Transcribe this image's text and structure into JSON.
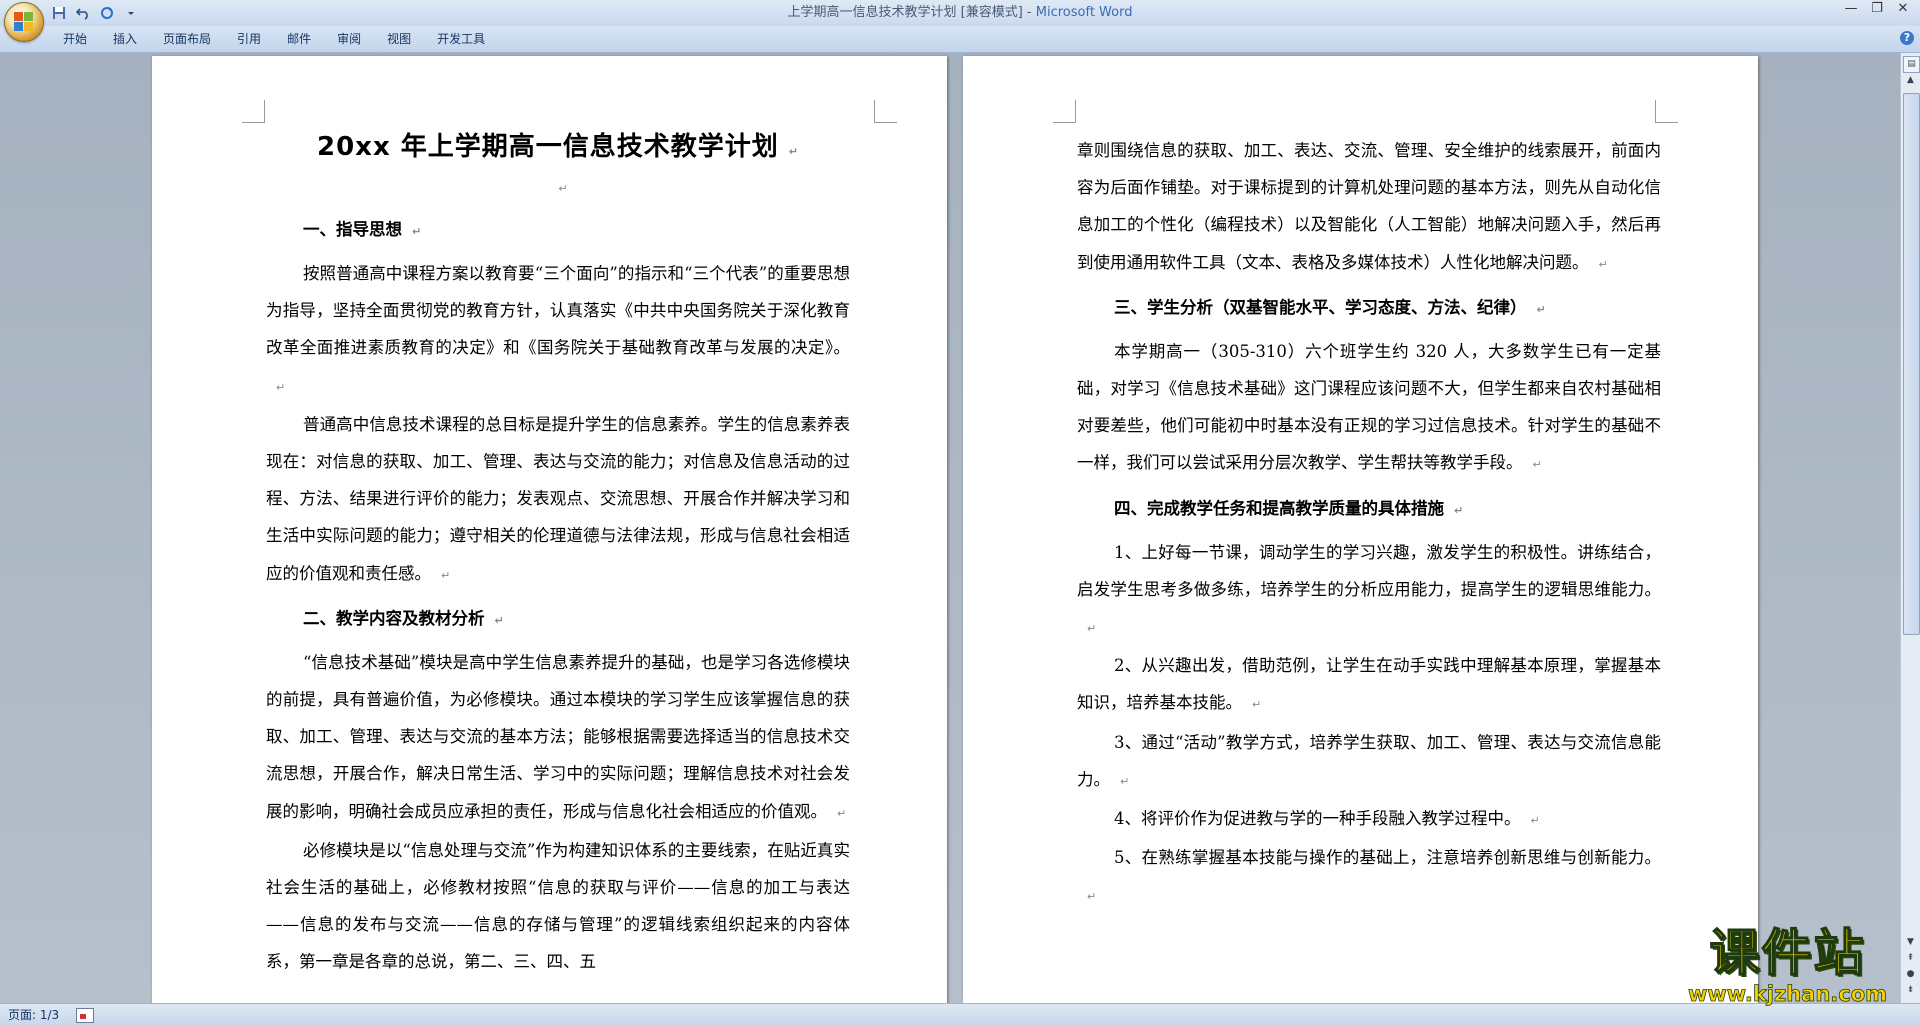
{
  "window": {
    "doc_title": "上学期高一信息技术教学计划 [兼容模式] - ",
    "app_name": "Microsoft Word",
    "qat": [
      "save-icon",
      "undo-icon",
      "redo-icon",
      "customize-icon"
    ]
  },
  "ribbon": {
    "tabs": [
      "开始",
      "插入",
      "页面布局",
      "引用",
      "邮件",
      "审阅",
      "视图",
      "开发工具"
    ]
  },
  "page1": {
    "title": "20xx 年上学期高一信息技术教学计划",
    "h1": "一、指导思想",
    "p1": "按照普通高中课程方案以教育要“三个面向”的指示和“三个代表”的重要思想为指导，坚持全面贯彻党的教育方针，认真落实《中共中央国务院关于深化教育改革全面推进素质教育的决定》和《国务院关于基础教育改革与发展的决定》。",
    "p2": "普通高中信息技术课程的总目标是提升学生的信息素养。学生的信息素养表现在：对信息的获取、加工、管理、表达与交流的能力；对信息及信息活动的过程、方法、结果进行评价的能力；发表观点、交流思想、开展合作并解决学习和生活中实际问题的能力；遵守相关的伦理道德与法律法规，形成与信息社会相适应的价值观和责任感。",
    "h2": "二、教学内容及教材分析",
    "p3": "“信息技术基础”模块是高中学生信息素养提升的基础，也是学习各选修模块的前提，具有普遍价值，为必修模块。通过本模块的学习学生应该掌握信息的获取、加工、管理、表达与交流的基本方法；能够根据需要选择适当的信息技术交流思想，开展合作，解决日常生活、学习中的实际问题；理解信息技术对社会发展的影响，明确社会成员应承担的责任，形成与信息化社会相适应的价值观。",
    "p4": "必修模块是以“信息处理与交流”作为构建知识体系的主要线索，在贴近真实社会生活的基础上，必修教材按照“信息的获取与评价——信息的加工与表达——信息的发布与交流——信息的存储与管理”的逻辑线索组织起来的内容体系，第一章是各章的总说，第二、三、四、五"
  },
  "page2": {
    "p1": "章则围绕信息的获取、加工、表达、交流、管理、安全维护的线索展开，前面内容为后面作铺垫。对于课标提到的计算机处理问题的基本方法，则先从自动化信息加工的个性化（编程技术）以及智能化（人工智能）地解决问题入手，然后再到使用通用软件工具（文本、表格及多媒体技术）人性化地解决问题。",
    "h3": "三、学生分析（双基智能水平、学习态度、方法、纪律）",
    "p2": "本学期高一（305-310）六个班学生约 320 人，大多数学生已有一定基础，对学习《信息技术基础》这门课程应该问题不大，但学生都来自农村基础相对要差些，他们可能初中时基本没有正规的学习过信息技术。针对学生的基础不一样，我们可以尝试采用分层次教学、学生帮扶等教学手段。",
    "h4": "四、完成教学任务和提高教学质量的具体措施",
    "m1": "1、上好每一节课，调动学生的学习兴趣，激发学生的积极性。讲练结合，启发学生思考多做多练，培养学生的分析应用能力，提高学生的逻辑思维能力。",
    "m2": "2、从兴趣出发，借助范例，让学生在动手实践中理解基本原理，掌握基本知识，培养基本技能。",
    "m3": "3、通过“活动”教学方式，培养学生获取、加工、管理、表达与交流信息能力。",
    "m4": "4、将评价作为促进教与学的一种手段融入教学过程中。",
    "m5": "5、在熟练掌握基本技能与操作的基础上，注意培养创新思维与创新能力。"
  },
  "paragraph_mark": "↵",
  "status": {
    "page": "页面: 1/3"
  },
  "watermark": {
    "main": "课件站",
    "url": "www.kjzhan.com"
  },
  "colors": {
    "accent": "#3a6ab8",
    "watermark": "#f6d300"
  }
}
